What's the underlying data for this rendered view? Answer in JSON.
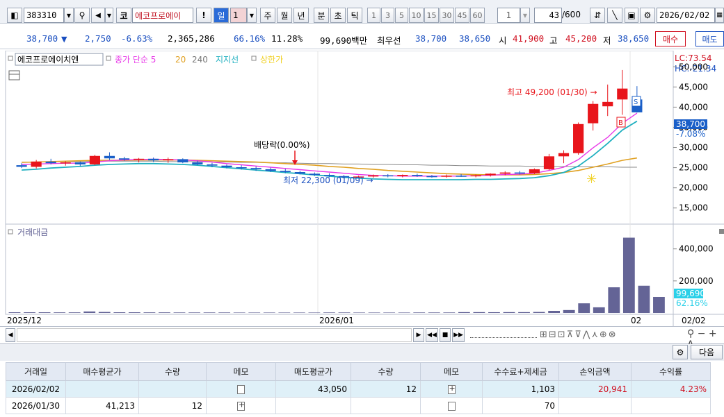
{
  "toolbar": {
    "stock_code": "383310",
    "market_badge": "코",
    "stock_name": "에코프로에이",
    "alert_icon": "!",
    "periods": [
      "일",
      "1",
      "주",
      "월",
      "년",
      "분",
      "초",
      "틱"
    ],
    "intervals": [
      "1",
      "3",
      "5",
      "10",
      "15",
      "30",
      "45",
      "60"
    ],
    "interval_value": "1",
    "count_value": "43",
    "count_total": "/600",
    "date_value": "2026/02/02"
  },
  "quote": {
    "price": "38,700",
    "arrow": "▼",
    "change": "2,750",
    "change_pct": "-6.63%",
    "volume": "2,365,286",
    "ratio1": "66.16%",
    "ratio2": "11.28%",
    "amount": "99,690백만",
    "best_label": "최우선",
    "best_ask": "38,700",
    "best_bid": "38,650",
    "open_label": "시",
    "open": "41,900",
    "high_label": "고",
    "high": "45,200",
    "low_label": "저",
    "low": "38,650",
    "buy_button": "매수",
    "sell_button": "매도"
  },
  "legend": {
    "name": "에코프로에이치엔",
    "ma_label": "종가 단순 5",
    "ma20": "20",
    "ma240": "240",
    "support": "지지선",
    "upper": "상한가",
    "volume_title": "거래대금"
  },
  "colors": {
    "up": "#e8151b",
    "down": "#1a5fc8",
    "ma5": "#e838e8",
    "ma20": "#e0a020",
    "ma240": "#8a8a8a",
    "support": "#20b0c0",
    "volume": "#646496"
  },
  "chart_data": {
    "type": "candlestick",
    "y_range": [
      11000,
      54000
    ],
    "y_ticks": [
      "50,000",
      "45,000",
      "40,000",
      "35,000",
      "30,000",
      "25,000",
      "20,000",
      "15,000"
    ],
    "lc_label": "LC:73.54",
    "hc_label": "HC:-21.34",
    "price_tag": "38,700",
    "price_tag_sub": "-7.08%",
    "annotations": {
      "high": "최고 49,200 (01/30) →",
      "low": "최저 22,300 (01/09) →",
      "dividend": "배당락(0.00%)"
    },
    "candles": [
      [
        25600,
        26100,
        24900,
        25200
      ],
      [
        25200,
        26900,
        24800,
        26500
      ],
      [
        26500,
        27200,
        25800,
        26100
      ],
      [
        26100,
        26600,
        25500,
        26300
      ],
      [
        26300,
        26500,
        25400,
        25800
      ],
      [
        25800,
        28200,
        25600,
        27900
      ],
      [
        27900,
        28800,
        26900,
        27300
      ],
      [
        27300,
        27700,
        26700,
        27000
      ],
      [
        27000,
        27400,
        26300,
        27200
      ],
      [
        27200,
        27500,
        26400,
        26800
      ],
      [
        26800,
        27500,
        26200,
        27100
      ],
      [
        27100,
        27300,
        26100,
        26300
      ],
      [
        26300,
        26700,
        25600,
        25800
      ],
      [
        25800,
        26200,
        25100,
        25500
      ],
      [
        25500,
        25800,
        24800,
        25100
      ],
      [
        25100,
        25600,
        24500,
        24900
      ],
      [
        24900,
        25300,
        24200,
        24600
      ],
      [
        24600,
        25000,
        23900,
        24200
      ],
      [
        24200,
        24700,
        23600,
        23900
      ],
      [
        23900,
        24200,
        23300,
        23500
      ],
      [
        23500,
        23800,
        22900,
        23200
      ],
      [
        23200,
        23600,
        22600,
        22900
      ],
      [
        22900,
        23200,
        22300,
        22600
      ],
      [
        22600,
        23000,
        22400,
        22800
      ],
      [
        22800,
        23300,
        22500,
        23100
      ],
      [
        23100,
        23400,
        22600,
        22900
      ],
      [
        22900,
        23300,
        22600,
        23200
      ],
      [
        23200,
        23500,
        22700,
        22900
      ],
      [
        22900,
        23200,
        22500,
        22800
      ],
      [
        22800,
        23300,
        22500,
        23000
      ],
      [
        23000,
        23400,
        22700,
        22900
      ],
      [
        22900,
        23300,
        22600,
        23100
      ],
      [
        23100,
        23600,
        22800,
        23500
      ],
      [
        23500,
        24100,
        23100,
        23800
      ],
      [
        23800,
        24200,
        23300,
        23600
      ],
      [
        23600,
        24800,
        23400,
        24600
      ],
      [
        24600,
        28400,
        24400,
        27800
      ],
      [
        27800,
        29300,
        26100,
        28600
      ],
      [
        28600,
        36200,
        28200,
        35800
      ],
      [
        36000,
        41500,
        34200,
        40800
      ],
      [
        40200,
        45600,
        37800,
        41300
      ],
      [
        41900,
        49200,
        38100,
        44600
      ],
      [
        41900,
        45200,
        38650,
        38700
      ]
    ],
    "ma5": [
      25800,
      25900,
      26000,
      26100,
      26100,
      26400,
      26700,
      26900,
      27000,
      27100,
      27000,
      26900,
      26700,
      26400,
      26000,
      25700,
      25400,
      25100,
      24800,
      24500,
      24200,
      23900,
      23600,
      23300,
      23100,
      23000,
      22900,
      22900,
      22900,
      22900,
      22900,
      23000,
      23100,
      23300,
      23400,
      23600,
      24300,
      25100,
      27000,
      29900,
      32500,
      36000,
      38500
    ],
    "ma20": [
      26300,
      26400,
      26500,
      26600,
      26700,
      26800,
      26800,
      26800,
      26900,
      26900,
      26900,
      26900,
      26800,
      26700,
      26600,
      26500,
      26400,
      26200,
      26000,
      25800,
      25600,
      25300,
      25100,
      24800,
      24600,
      24300,
      24100,
      23900,
      23700,
      23500,
      23400,
      23300,
      23200,
      23200,
      23200,
      23300,
      23500,
      23800,
      24300,
      25100,
      25900,
      26800,
      27400
    ],
    "ma240": [
      26400,
      26400,
      26500,
      26500,
      26500,
      26600,
      26600,
      26600,
      26600,
      26600,
      26500,
      26500,
      26500,
      26400,
      26400,
      26300,
      26300,
      26200,
      26200,
      26100,
      26000,
      26000,
      25900,
      25900,
      25800,
      25800,
      25700,
      25700,
      25600,
      25600,
      25500,
      25500,
      25400,
      25400,
      25400,
      25300,
      25300,
      25300,
      25200,
      25200,
      25200,
      25100,
      25100
    ],
    "support": [
      24400,
      24600,
      24900,
      25100,
      25300,
      25600,
      25800,
      25900,
      26000,
      26000,
      25900,
      25800,
      25600,
      25300,
      25000,
      24700,
      24400,
      24100,
      23800,
      23500,
      23200,
      22900,
      22600,
      22400,
      22200,
      22100,
      22000,
      22000,
      22000,
      22000,
      22000,
      22100,
      22100,
      22200,
      22300,
      22500,
      23000,
      23800,
      25400,
      28000,
      31000,
      34300,
      36500
    ],
    "volume_y_ticks": [
      "400,000",
      "200,000"
    ],
    "volume_range": [
      0,
      520000
    ],
    "volume_tag": "99,690",
    "volume_tag_sub": "62.16%",
    "volume": [
      4000,
      4000,
      4000,
      3500,
      3500,
      9000,
      6000,
      4000,
      4000,
      3500,
      3500,
      3000,
      3000,
      3000,
      3000,
      2500,
      2500,
      2500,
      2500,
      2500,
      2500,
      3000,
      3000,
      2500,
      2500,
      2500,
      2500,
      3000,
      3000,
      3000,
      5000,
      5000,
      4500,
      5000,
      5000,
      6000,
      13000,
      18000,
      60000,
      35000,
      160000,
      470000,
      170000,
      99690
    ],
    "x_labels": [
      "2025/12",
      "2026/01",
      "02",
      "02/02"
    ]
  },
  "trades": {
    "headers": [
      "거래일",
      "매수평균가",
      "수량",
      "메모",
      "매도평균가",
      "수량",
      "메모",
      "수수료+제세금",
      "손익금액",
      "수익률"
    ],
    "rows": [
      {
        "date": "2026/02/02",
        "buy_avg": "",
        "buy_qty": "",
        "sell_avg": "43,050",
        "sell_qty": "12",
        "fee": "1,103",
        "pnl": "20,941",
        "rate": "4.23%"
      },
      {
        "date": "2026/01/30",
        "buy_avg": "41,213",
        "buy_qty": "12",
        "sell_avg": "",
        "sell_qty": "",
        "fee": "70",
        "pnl": "",
        "rate": ""
      }
    ],
    "next_button": "다음"
  }
}
